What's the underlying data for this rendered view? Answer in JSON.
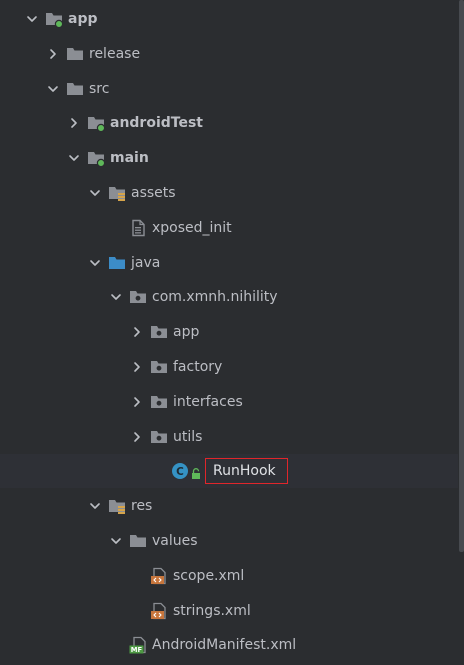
{
  "tree": {
    "items": [
      {
        "label": "app",
        "depth": 0,
        "expanded": true,
        "icon": "module-folder-icon",
        "bold": true
      },
      {
        "label": "release",
        "depth": 1,
        "expanded": false,
        "icon": "folder-icon",
        "bold": false
      },
      {
        "label": "src",
        "depth": 1,
        "expanded": true,
        "icon": "folder-icon",
        "bold": false
      },
      {
        "label": "androidTest",
        "depth": 2,
        "expanded": false,
        "icon": "source-set-folder-icon",
        "bold": true
      },
      {
        "label": "main",
        "depth": 2,
        "expanded": true,
        "icon": "source-set-folder-icon",
        "bold": true
      },
      {
        "label": "assets",
        "depth": 3,
        "expanded": true,
        "icon": "resources-folder-icon",
        "bold": false
      },
      {
        "label": "xposed_init",
        "depth": 4,
        "expanded": null,
        "icon": "text-file-icon",
        "bold": false
      },
      {
        "label": "java",
        "depth": 3,
        "expanded": true,
        "icon": "source-root-folder-icon",
        "bold": false
      },
      {
        "label": "com.xmnh.nihility",
        "depth": 4,
        "expanded": true,
        "icon": "package-icon",
        "bold": false
      },
      {
        "label": "app",
        "depth": 5,
        "expanded": false,
        "icon": "package-icon",
        "bold": false
      },
      {
        "label": "factory",
        "depth": 5,
        "expanded": false,
        "icon": "package-icon",
        "bold": false
      },
      {
        "label": "interfaces",
        "depth": 5,
        "expanded": false,
        "icon": "package-icon",
        "bold": false
      },
      {
        "label": "utils",
        "depth": 5,
        "expanded": false,
        "icon": "package-icon",
        "bold": false
      },
      {
        "label": "RunHook",
        "depth": 6,
        "expanded": null,
        "icon": "java-class-icon",
        "bold": false,
        "selected": true
      },
      {
        "label": "res",
        "depth": 3,
        "expanded": true,
        "icon": "resources-folder-icon",
        "bold": false
      },
      {
        "label": "values",
        "depth": 4,
        "expanded": true,
        "icon": "folder-icon",
        "bold": false
      },
      {
        "label": "scope.xml",
        "depth": 5,
        "expanded": null,
        "icon": "xml-file-icon",
        "bold": false
      },
      {
        "label": "strings.xml",
        "depth": 5,
        "expanded": null,
        "icon": "xml-file-icon",
        "bold": false
      },
      {
        "label": "AndroidManifest.xml",
        "depth": 4,
        "expanded": null,
        "icon": "manifest-file-icon",
        "bold": false
      }
    ],
    "class_badge": "C",
    "manifest_badge": "MF"
  },
  "colors": {
    "background": "#2b2d30",
    "text": "#bcbec4",
    "folder": "#8b8e94",
    "source_root": "#3c8cc7",
    "module_dot": "#5fb85a",
    "class_circle": "#3592c4",
    "xml": "#c7763d",
    "manifest": "#4e9a44",
    "highlight_box": "#e0262b"
  }
}
